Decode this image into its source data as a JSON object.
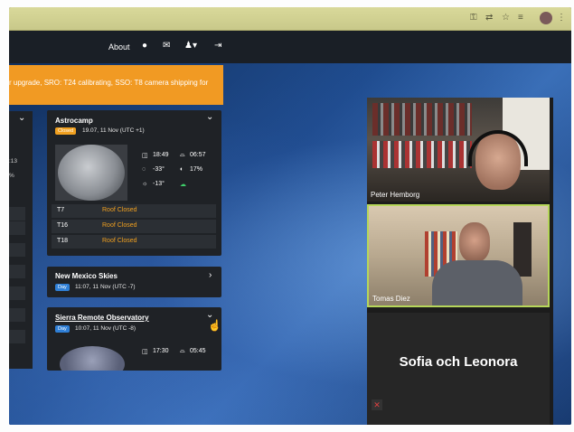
{
  "site_nav": {
    "about_label": "About"
  },
  "banner_text": "r upgrade, SRO: T24 calibrating, SSO: T8 camera shipping for",
  "left_stub_values": [
    ":13",
    "%"
  ],
  "astrocamp": {
    "title": "Astrocamp",
    "badge": "Closed",
    "time": "19.07, 11 Nov (UTC +1)",
    "sunset": "18:49",
    "sunrise": "06:57",
    "temp": "-33°",
    "humidity": "17%",
    "sky_temp": "-13°",
    "telescopes": [
      {
        "name": "T7",
        "status": "Roof Closed"
      },
      {
        "name": "T16",
        "status": "Roof Closed"
      },
      {
        "name": "T18",
        "status": "Roof Closed"
      }
    ]
  },
  "new_mexico": {
    "title": "New Mexico Skies",
    "badge": "Day",
    "time": "11:07, 11 Nov (UTC -7)"
  },
  "sierra": {
    "title": "Sierra Remote Observatory",
    "badge": "Day",
    "time": "10:07, 11 Nov (UTC -8)",
    "sunset": "17:30",
    "sunrise": "05:45"
  },
  "call": {
    "participants": [
      {
        "name": "Peter Hemborg"
      },
      {
        "name": "Tomas Diez"
      },
      {
        "name": "Sofia och Leonora"
      }
    ]
  },
  "colors": {
    "banner": "#f19a23",
    "roof_closed": "#f0a020",
    "active_speaker": "#b6d65a"
  }
}
